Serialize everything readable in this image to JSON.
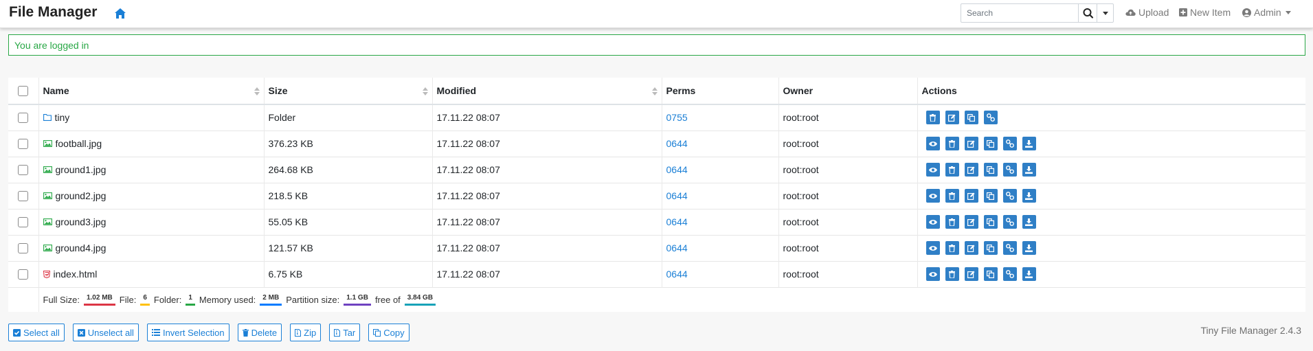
{
  "navbar": {
    "brand": "File Manager",
    "search_placeholder": "Search",
    "upload_label": "Upload",
    "new_item_label": "New Item",
    "user_label": "Admin"
  },
  "alert": {
    "message": "You are logged in",
    "color": "#28a745"
  },
  "table": {
    "headers": {
      "name": "Name",
      "size": "Size",
      "modified": "Modified",
      "perms": "Perms",
      "owner": "Owner",
      "actions": "Actions"
    },
    "rows": [
      {
        "icon": "folder-icon",
        "name": "tiny",
        "size": "Folder",
        "modified": "17.11.22 08:07",
        "perms": "0755",
        "owner": "root:root",
        "actions": [
          "delete",
          "rename",
          "copy",
          "link"
        ]
      },
      {
        "icon": "image-icon",
        "name": "football.jpg",
        "size": "376.23 KB",
        "modified": "17.11.22 08:07",
        "perms": "0644",
        "owner": "root:root",
        "actions": [
          "view",
          "delete",
          "rename",
          "copy",
          "link",
          "download"
        ]
      },
      {
        "icon": "image-icon",
        "name": "ground1.jpg",
        "size": "264.68 KB",
        "modified": "17.11.22 08:07",
        "perms": "0644",
        "owner": "root:root",
        "actions": [
          "view",
          "delete",
          "rename",
          "copy",
          "link",
          "download"
        ]
      },
      {
        "icon": "image-icon",
        "name": "ground2.jpg",
        "size": "218.5 KB",
        "modified": "17.11.22 08:07",
        "perms": "0644",
        "owner": "root:root",
        "actions": [
          "view",
          "delete",
          "rename",
          "copy",
          "link",
          "download"
        ]
      },
      {
        "icon": "image-icon",
        "name": "ground3.jpg",
        "size": "55.05 KB",
        "modified": "17.11.22 08:07",
        "perms": "0644",
        "owner": "root:root",
        "actions": [
          "view",
          "delete",
          "rename",
          "copy",
          "link",
          "download"
        ]
      },
      {
        "icon": "image-icon",
        "name": "ground4.jpg",
        "size": "121.57 KB",
        "modified": "17.11.22 08:07",
        "perms": "0644",
        "owner": "root:root",
        "actions": [
          "view",
          "delete",
          "rename",
          "copy",
          "link",
          "download"
        ]
      },
      {
        "icon": "html5-icon",
        "name": "index.html",
        "size": "6.75 KB",
        "modified": "17.11.22 08:07",
        "perms": "0644",
        "owner": "root:root",
        "actions": [
          "view",
          "delete",
          "rename",
          "copy",
          "link",
          "download"
        ]
      }
    ]
  },
  "stats": {
    "full_size_label": "Full Size:",
    "full_size": "1.02 MB",
    "full_size_color": "#dc3545",
    "file_label": "File:",
    "file_count": "6",
    "file_color": "#ffc107",
    "folder_label": "Folder:",
    "folder_count": "1",
    "folder_color": "#28a745",
    "memory_label": "Memory used:",
    "memory": "2 MB",
    "memory_color": "#007bff",
    "partition_label": "Partition size:",
    "partition": "1.1 GB",
    "partition_color": "#6f42c1",
    "free_label": "free of",
    "free": "3.84 GB",
    "free_color": "#17a2b8"
  },
  "bottom_buttons": {
    "select_all": "Select all",
    "unselect_all": "Unselect all",
    "invert_selection": "Invert Selection",
    "delete": "Delete",
    "zip": "Zip",
    "tar": "Tar",
    "copy": "Copy"
  },
  "version": "Tiny File Manager 2.4.3",
  "colors": {
    "accent": "#2f7fc6",
    "link": "#1a7fd6"
  }
}
